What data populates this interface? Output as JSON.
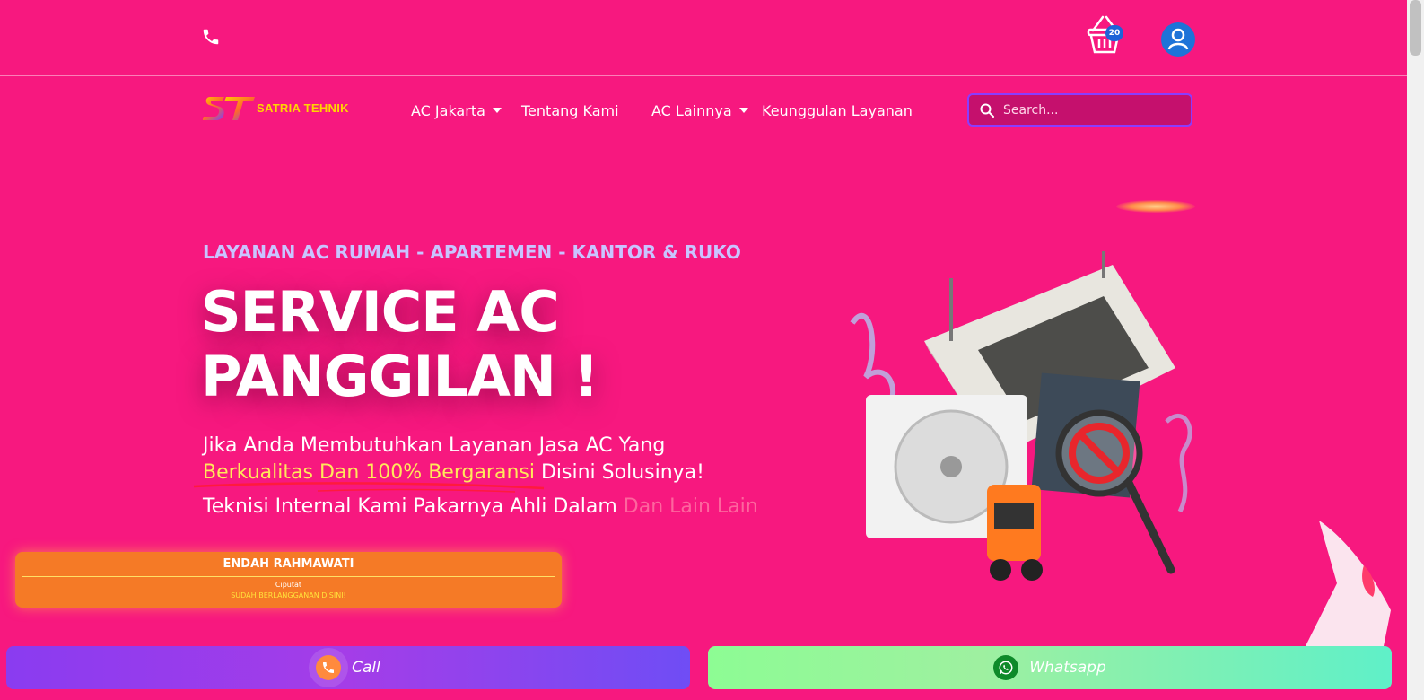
{
  "topbar": {
    "cart_count": "20"
  },
  "nav": {
    "logo_text": "SATRIA TEHNIK",
    "items": [
      {
        "label": "AC Jakarta",
        "has_dropdown": true
      },
      {
        "label": "Tentang Kami",
        "has_dropdown": false
      },
      {
        "label": "AC Lainnya",
        "has_dropdown": true
      },
      {
        "label": "Keunggulan Layanan",
        "has_dropdown": false
      }
    ],
    "search_placeholder": "Search..."
  },
  "hero": {
    "eyebrow": "LAYANAN AC RUMAH - APARTEMEN - KANTOR & RUKO",
    "headline_line1": "SERVICE AC",
    "headline_line2": "PANGGILAN !",
    "desc_line1": "Jika Anda Membutuhkan Layanan Jasa AC Yang",
    "desc_highlight": "Berkualitas Dan 100% Bergaransi",
    "desc_line2_rest": " Disini Solusinya!",
    "desc_line3": "Teknisi Internal Kami Pakarnya Ahli Dalam ",
    "desc_line3_faded": "Dan Lain Lain"
  },
  "toast": {
    "name": "ENDAH RAHMAWATI",
    "city": "Ciputat",
    "status": "SUDAH BERLANGGANAN DISINI!"
  },
  "cta": {
    "call_label": "Call",
    "whatsapp_label": "Whatsapp"
  },
  "colors": {
    "background": "#f7187f",
    "accent_yellow": "#ffe95a",
    "eyebrow": "#c9c4ff",
    "toast": "#f57a26",
    "search_border": "#8a3cff"
  },
  "icons": [
    "phone-icon",
    "cart-icon",
    "account-icon",
    "search-icon",
    "call-icon",
    "whatsapp-icon"
  ]
}
